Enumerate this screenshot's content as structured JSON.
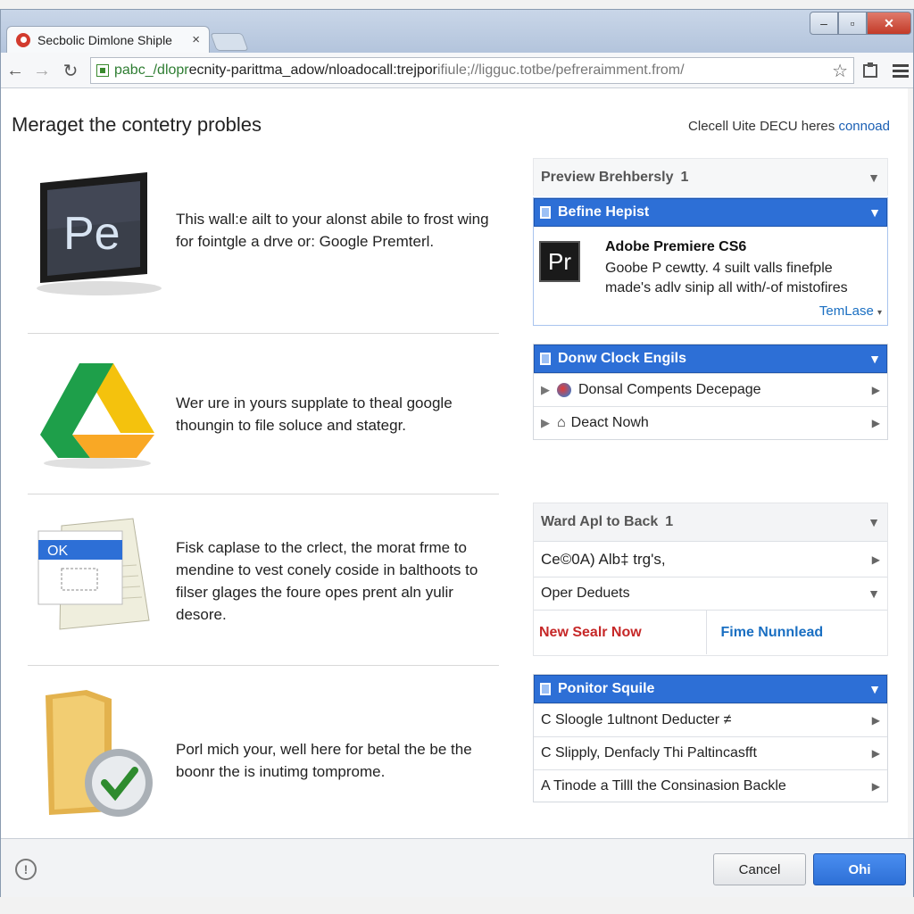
{
  "browser": {
    "tab_title": "Secbolic Dimlone Shiple",
    "tab_close": "×",
    "url_green": "pabc_/dlopr",
    "url_main": "ecnity-parittma_adow/nloadocall:trejpor",
    "url_rest": "ifiule;//ligguc.totbe/pefreraimment.from/",
    "window_min": "–",
    "window_max": "▫",
    "window_close": "✕"
  },
  "page": {
    "title": "Meraget the contetry probles",
    "help_text": "Clecell Uite DECU heres",
    "help_link": "connoad"
  },
  "items": [
    {
      "text": "This wall:e ailt to your alonst abile to frost wing for fointgle a drve or: Google Premterl.",
      "icon": "premiere-elements-monitor-icon",
      "icon_label": "Pe"
    },
    {
      "text": "Wer ure in yours supplate to theal google thoungin to file soluce and stategr.",
      "icon": "google-drive-icon"
    },
    {
      "text": "Fisk caplase to the crlect, the morat frme to mendine to vest conely coside in balthoots to filser glages the foure opes prent aln yulir desore.",
      "icon": "document-ok-icon",
      "icon_label": "OK"
    },
    {
      "text": "Porl mich your, well here for betal the be the boonr the is inutimg tomprome.",
      "icon": "folder-check-icon"
    }
  ],
  "panel": {
    "preview": {
      "title": "Preview Brehbersly",
      "count": "1"
    },
    "define": {
      "title": "Befine Hepist",
      "app_name": "Adobe Premiere CS6",
      "app_icon": "Pr",
      "desc": "Goobe P cewtty. 4 suilt valls finefple made's adlv sinip all with/-of mistofires",
      "link": "TemLase"
    },
    "download": {
      "title": "Donw Clock Engils",
      "rows": [
        "Donsal Compents Decepage",
        "Deact Nowh"
      ]
    },
    "ward": {
      "title": "Ward Apl to Back",
      "count": "1",
      "row1": "Ce©0A) Alb‡ trg's,",
      "row2": "Oper Deduets",
      "btn_left": "New Sealr Now",
      "btn_right": "Fime Nunnlead"
    },
    "position": {
      "title": "Ponitor Squile",
      "rows": [
        "C Sloogle 1ultnont Deducter ≠",
        "C Slipply, Denfacly Thi Paltincasfft",
        "A Tinode a Tilll the Consinasion Backle"
      ]
    }
  },
  "footer": {
    "cancel": "Cancel",
    "ok": "Ohi"
  },
  "colors": {
    "accent": "#2d6fd6",
    "red_link": "#c62828",
    "blue_link": "#1a6fc2"
  }
}
